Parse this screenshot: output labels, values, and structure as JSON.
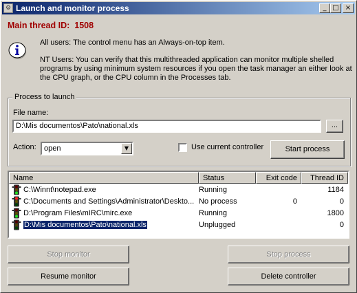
{
  "window": {
    "title": "Launch and monitor process",
    "controls": {
      "minimize": "_",
      "maximize": "□",
      "close": "×"
    }
  },
  "main_thread": {
    "label": "Main thread ID:",
    "value": "1508"
  },
  "info": {
    "icon": "info-icon",
    "paragraph1": "All users:  The control menu has an Always-on-top item.",
    "paragraph2": "NT Users:  You can verify that this multithreaded application can monitor multiple shelled programs by using minimum system resources if you open the task manager an either look at the CPU graph, or the CPU column in the Processes tab."
  },
  "process_group": {
    "title": "Process to launch",
    "file_label": "File name:",
    "file_value": "D:\\Mis documentos\\Pato\\national.xls",
    "browse_label": "...",
    "action_label": "Action:",
    "action_value": "open",
    "use_current_label": "Use current controller",
    "use_current_checked": false,
    "start_label": "Start process"
  },
  "list": {
    "columns": [
      "Name",
      "Status",
      "Exit code",
      "Thread ID"
    ],
    "rows": [
      {
        "name": "C:\\Winnt\\notepad.exe",
        "status": "Running",
        "exit_code": "",
        "thread_id": "1184",
        "icon": "traffic-light-green-icon",
        "selected": false
      },
      {
        "name": "C:\\Documents and Settings\\Administrator\\Deskto...",
        "status": "No process",
        "exit_code": "0",
        "thread_id": "0",
        "icon": "traffic-light-red-icon",
        "selected": false
      },
      {
        "name": "D:\\Program Files\\mIRC\\mirc.exe",
        "status": "Running",
        "exit_code": "",
        "thread_id": "1800",
        "icon": "traffic-light-green-icon",
        "selected": false
      },
      {
        "name": "D:\\Mis documentos\\Pato\\national.xls",
        "status": "Unplugged",
        "exit_code": "",
        "thread_id": "0",
        "icon": "traffic-light-dark-icon",
        "selected": true
      }
    ]
  },
  "buttons": {
    "stop_monitor": "Stop monitor",
    "stop_process": "Stop process",
    "resume_monitor": "Resume monitor",
    "delete_controller": "Delete controller"
  },
  "colors": {
    "main_thread": "#a00000",
    "selection": "#0a246a",
    "titlebar_start": "#0a246a",
    "titlebar_end": "#a6caf0"
  }
}
